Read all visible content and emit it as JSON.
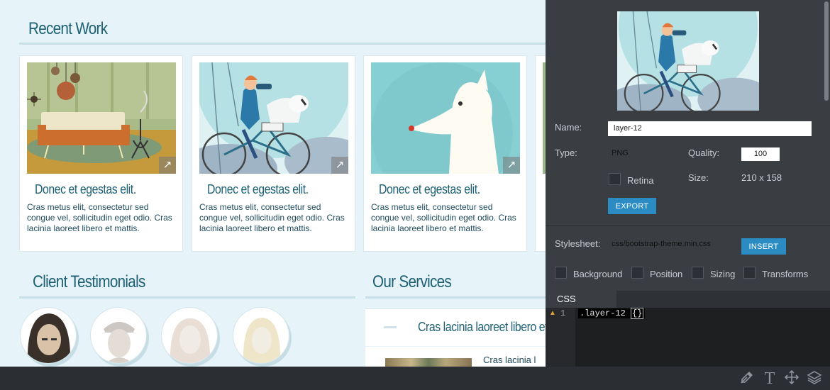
{
  "page": {
    "recent_work_heading": "Recent Work",
    "cards": [
      {
        "title": "Donec et egestas elit.",
        "text": "Cras metus elit, consectetur sed congue vel, sollicitudin eget odio. Cras lacinia laoreet libero et mattis."
      },
      {
        "title": "Donec et egestas elit.",
        "text": "Cras metus elit, consectetur sed congue vel, sollicitudin eget odio. Cras lacinia laoreet libero et mattis."
      },
      {
        "title": "Donec et egestas elit.",
        "text": "Cras metus elit, consectetur sed congue vel, sollicitudin eget odio. Cras lacinia laoreet libero et mattis."
      }
    ],
    "card_arrow_icon": "expand-arrow-icon",
    "testimonials_heading": "Client Testimonials",
    "services_heading": "Our Services",
    "service_item_title": "Cras lacinia laoreet libero et ma",
    "service_item_text": "Cras lacinia l"
  },
  "inspector": {
    "name_label": "Name:",
    "name_value": "layer-12",
    "type_label": "Type:",
    "type_value": "PNG",
    "quality_label": "Quality:",
    "quality_value": "100",
    "retina_label": "Retina",
    "size_label": "Size:",
    "size_value": "210 x 158",
    "export_button": "EXPORT",
    "stylesheet_label": "Stylesheet:",
    "stylesheet_value": "css/bootstrap-theme.min.css",
    "insert_button": "INSERT",
    "options": [
      "Background",
      "Position",
      "Sizing",
      "Transforms"
    ],
    "css_tab": "CSS",
    "code_line_number": "1",
    "code_selector": ".layer-12 ",
    "code_brace": "{}"
  },
  "toolbar": {
    "icons": [
      "eyedropper-icon",
      "text-tool-icon",
      "move-tool-icon",
      "layers-icon"
    ]
  },
  "colors": {
    "page_bg": "#e6f3f8",
    "heading": "#1d5f73",
    "panel_bg": "#3a3d42",
    "accent_button": "#2b8cc4"
  }
}
